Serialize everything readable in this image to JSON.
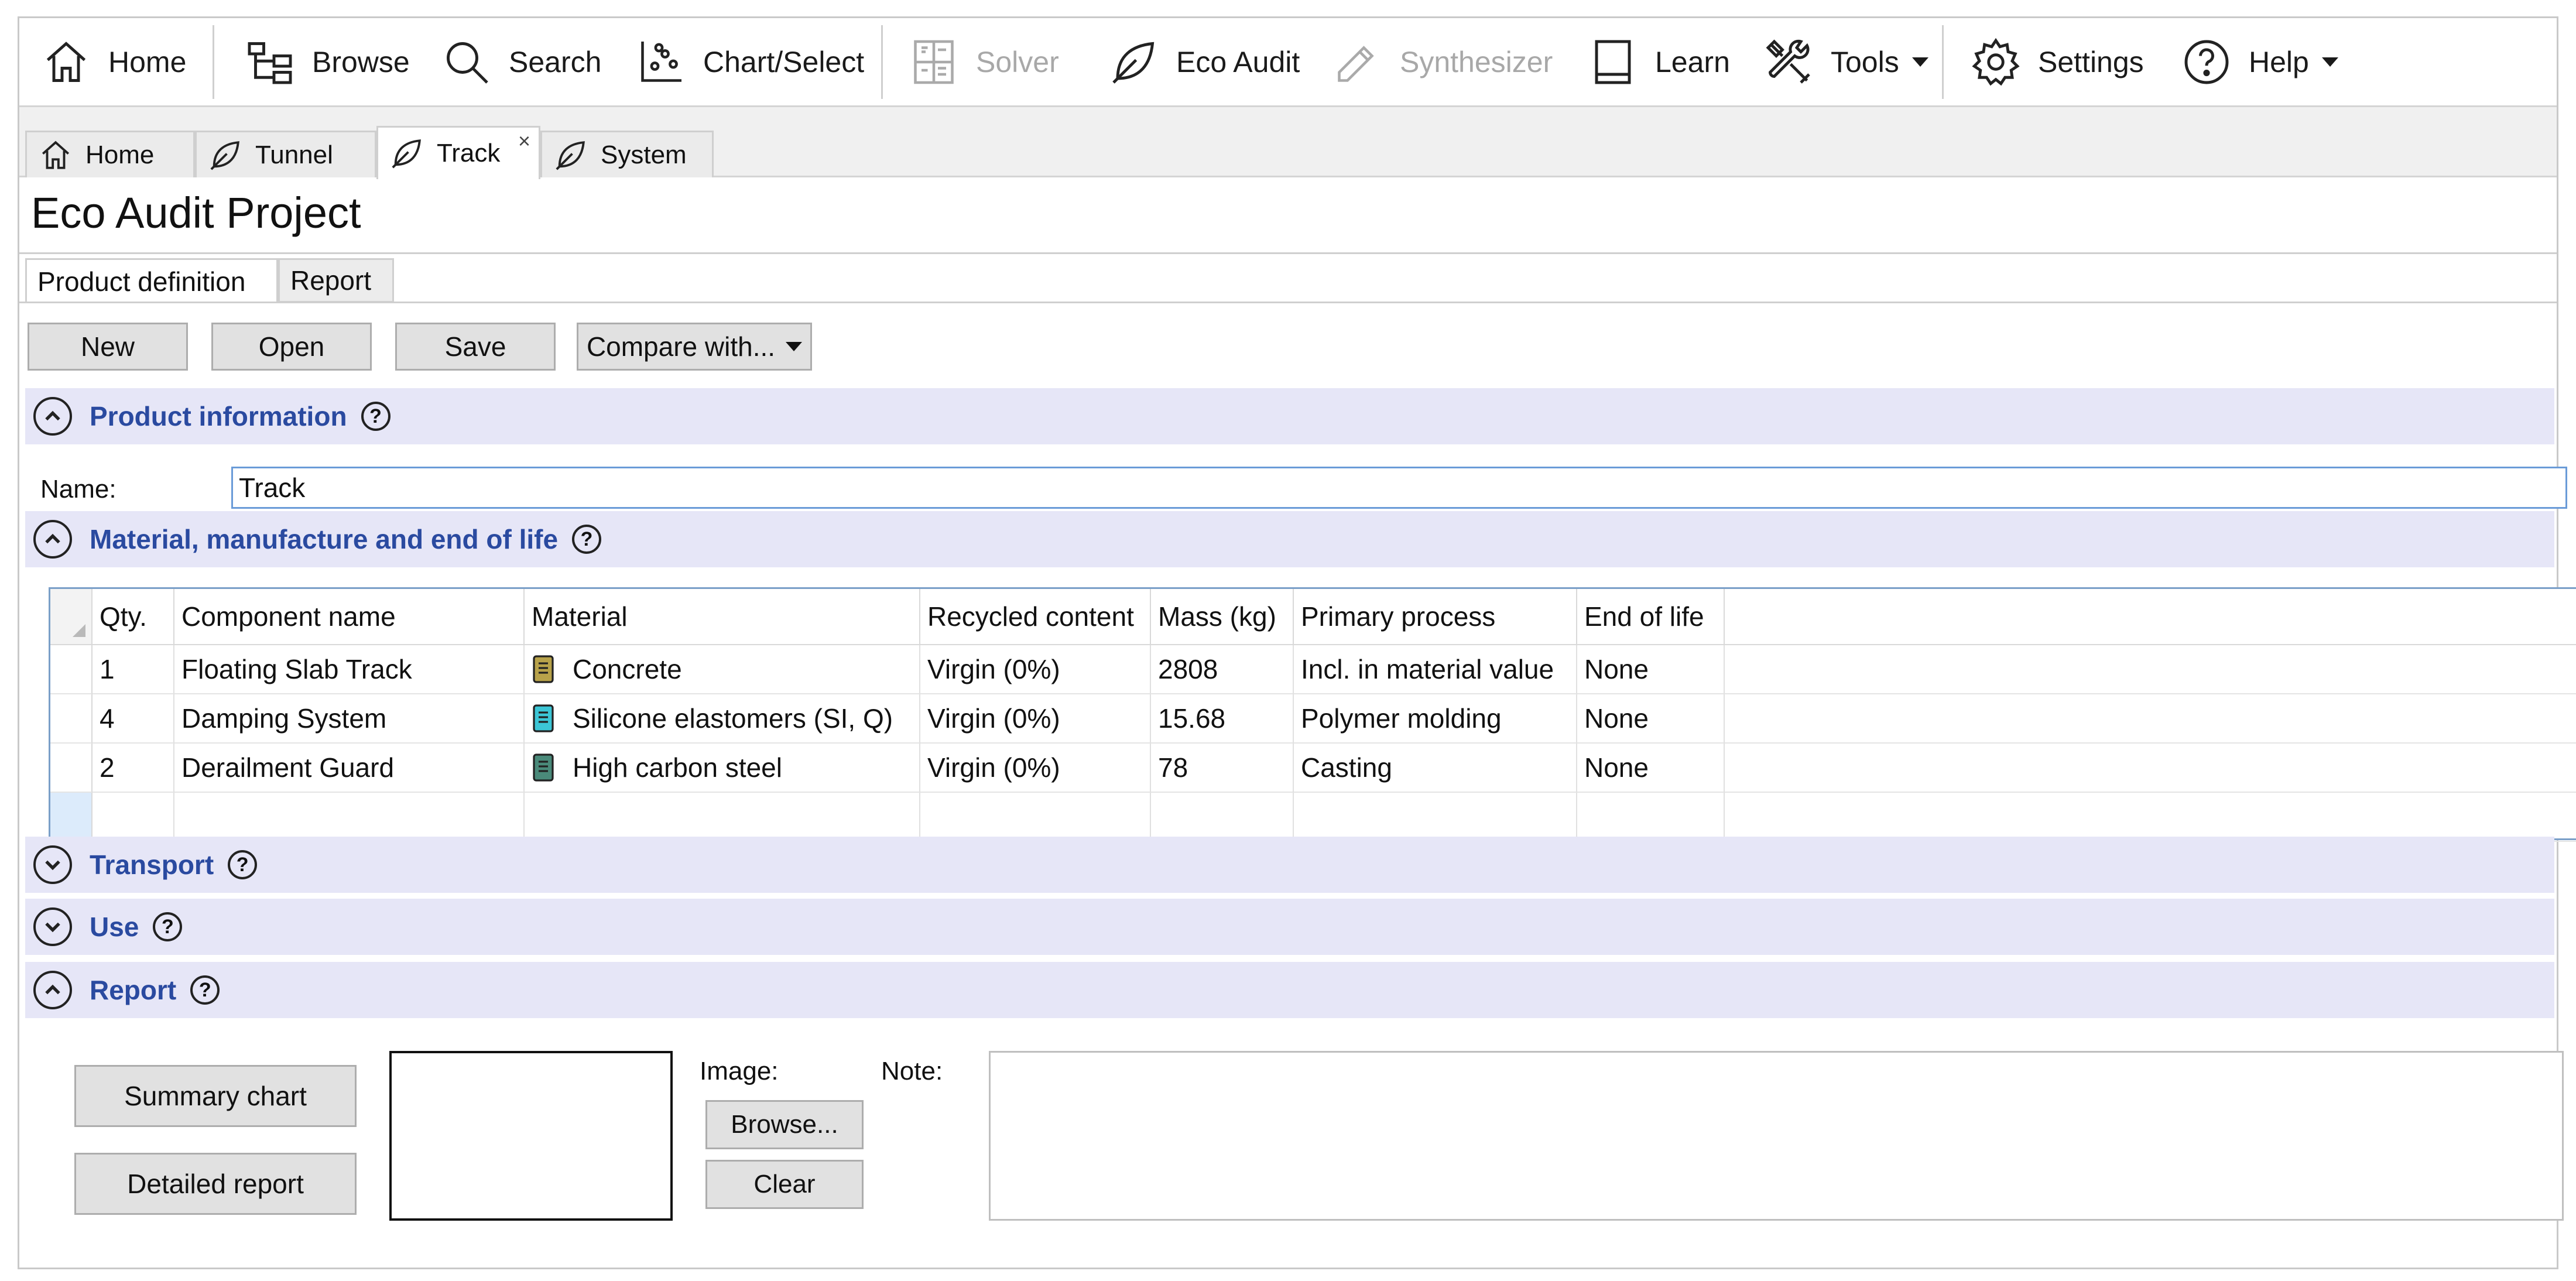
{
  "toolbar": {
    "home": "Home",
    "browse": "Browse",
    "search": "Search",
    "chart_select": "Chart/Select",
    "solver": "Solver",
    "eco_audit": "Eco Audit",
    "synthesizer": "Synthesizer",
    "learn": "Learn",
    "tools": "Tools",
    "settings": "Settings",
    "help": "Help"
  },
  "tabs": [
    {
      "label": "Home",
      "icon": "home-icon"
    },
    {
      "label": "Tunnel",
      "icon": "leaf-icon"
    },
    {
      "label": "Track",
      "icon": "leaf-icon",
      "active": true,
      "close": "×"
    },
    {
      "label": "System",
      "icon": "leaf-icon"
    }
  ],
  "project": {
    "title": "Eco Audit Project"
  },
  "subtabs": {
    "product_definition": "Product definition",
    "report": "Report"
  },
  "actions": {
    "new": "New",
    "open": "Open",
    "save": "Save",
    "compare": "Compare with..."
  },
  "sections": {
    "product_info": "Product information",
    "material": "Material, manufacture and end of life",
    "transport": "Transport",
    "use": "Use",
    "report": "Report",
    "help_glyph": "?"
  },
  "product": {
    "name_label": "Name:",
    "name_value": "Track"
  },
  "table": {
    "headers": [
      "Qty.",
      "Component name",
      "Material",
      "Recycled content",
      "Mass (kg)",
      "Primary process",
      "End of life"
    ],
    "rows": [
      {
        "qty": "1",
        "component": "Floating Slab Track",
        "material": "Concrete",
        "material_color": "#b8a24a",
        "recycled": "Virgin (0%)",
        "mass": "2808",
        "process": "Incl. in material value",
        "eol": "None"
      },
      {
        "qty": "4",
        "component": "Damping System",
        "material": "Silicone elastomers (SI, Q)",
        "material_color": "#3cc6d6",
        "recycled": "Virgin (0%)",
        "mass": "15.68",
        "process": "Polymer molding",
        "eol": "None"
      },
      {
        "qty": "2",
        "component": "Derailment Guard",
        "material": "High carbon steel",
        "material_color": "#4a8a7a",
        "recycled": "Virgin (0%)",
        "mass": "78",
        "process": "Casting",
        "eol": "None"
      }
    ]
  },
  "report": {
    "summary_chart": "Summary chart",
    "detailed_report": "Detailed report",
    "image_label": "Image:",
    "browse": "Browse...",
    "clear": "Clear",
    "note_label": "Note:"
  },
  "colors": {
    "section_bg": "#e6e6f7",
    "section_text": "#2a4aa0",
    "grid_border": "#7a9fc8"
  }
}
